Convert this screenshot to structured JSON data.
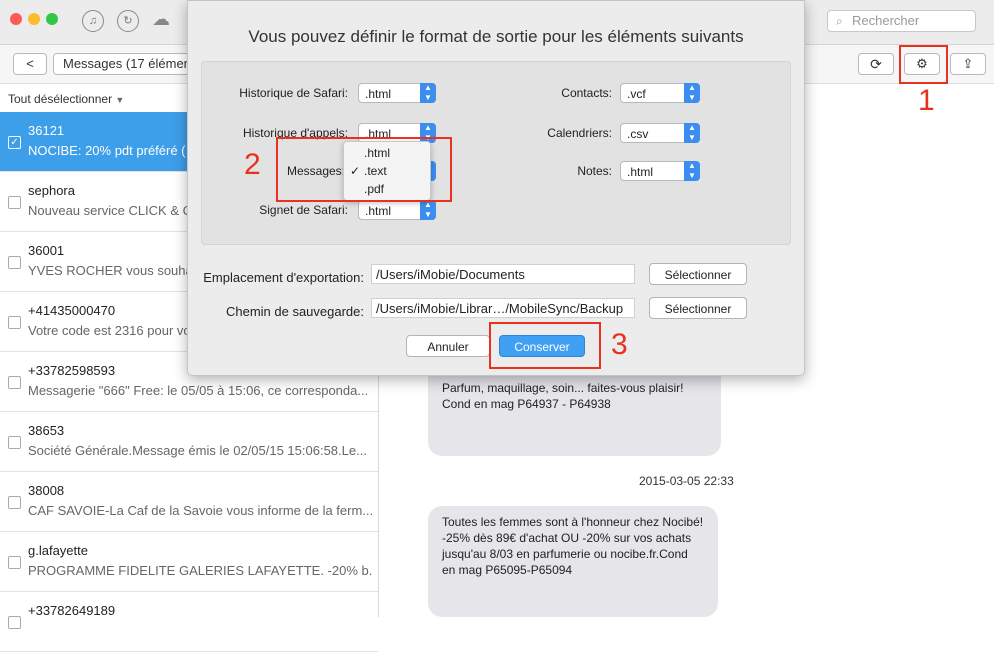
{
  "titlebar": {
    "search_placeholder": "Rechercher",
    "icons": [
      "music-icon",
      "restore-icon",
      "cloud-icon"
    ]
  },
  "toolbar": {
    "back_label": "<",
    "breadcrumb": "Messages (17 élémen"
  },
  "list": {
    "deselect_label": "Tout désélectionner",
    "items": [
      {
        "name": "36121",
        "preview": "NOCIBE: 20% pdt préféré (",
        "selected": true
      },
      {
        "name": "sephora",
        "preview": "Nouveau service CLICK & C",
        "selected": false
      },
      {
        "name": "36001",
        "preview": "YVES ROCHER vous souha",
        "selected": false
      },
      {
        "name": "+41435000470",
        "preview": "Votre code est 2316 pour vot",
        "selected": false
      },
      {
        "name": "+33782598593",
        "preview": "Messagerie \"666\" Free: le 05/05 à 15:06, ce corresponda...",
        "selected": false
      },
      {
        "name": "38653",
        "preview": "Société Générale.Message émis le 02/05/15 15:06:58.Le...",
        "selected": false
      },
      {
        "name": "38008",
        "preview": "CAF SAVOIE-La Caf de la Savoie vous informe de la ferm...",
        "selected": false
      },
      {
        "name": "g.lafayette",
        "preview": "PROGRAMME FIDELITE GALERIES LAFAYETTE. -20% b...",
        "selected": false
      },
      {
        "name": "+33782649189",
        "preview": "",
        "selected": false
      }
    ]
  },
  "conversation": {
    "bubble1": "Parfum, maquillage, soin... faites-vous plaisir!\nCond en mag P64937 - P64938",
    "timestamp": "2015-03-05 22:33",
    "bubble2": "Toutes les femmes sont à l'honneur chez Nocibé! -25% dès 89€ d'achat OU -20% sur vos achats jusqu'au 8/03 en parfumerie ou nocibe.fr.Cond en mag P65095-P65094"
  },
  "dialog": {
    "title": "Vous pouvez définir le format de sortie pour les éléments suivants",
    "fields": {
      "safari_history_label": "Historique de Safari:",
      "safari_history_value": ".html",
      "call_history_label": "Historique d'appels:",
      "call_history_value": ".html",
      "messages_label": "Messages:",
      "safari_bookmarks_label": "Signet de Safari:",
      "safari_bookmarks_value": ".html",
      "contacts_label": "Contacts:",
      "contacts_value": ".vcf",
      "calendars_label": "Calendriers:",
      "calendars_value": ".csv",
      "notes_label": "Notes:",
      "notes_value": ".html"
    },
    "messages_menu": {
      "opt1": ".html",
      "opt2": ".text",
      "opt3": ".pdf",
      "checked": "✓"
    },
    "export_label": "Emplacement d'exportation:",
    "export_path": "/Users/iMobie/Documents",
    "backup_label": "Chemin de sauvegarde:",
    "backup_path": "/Users/iMobie/Librar…/MobileSync/Backup",
    "select_label": "Sélectionner",
    "cancel_label": "Annuler",
    "save_label": "Conserver"
  },
  "annotations": {
    "n1": "1",
    "n2": "2",
    "n3": "3",
    "color": "#e8321e"
  }
}
